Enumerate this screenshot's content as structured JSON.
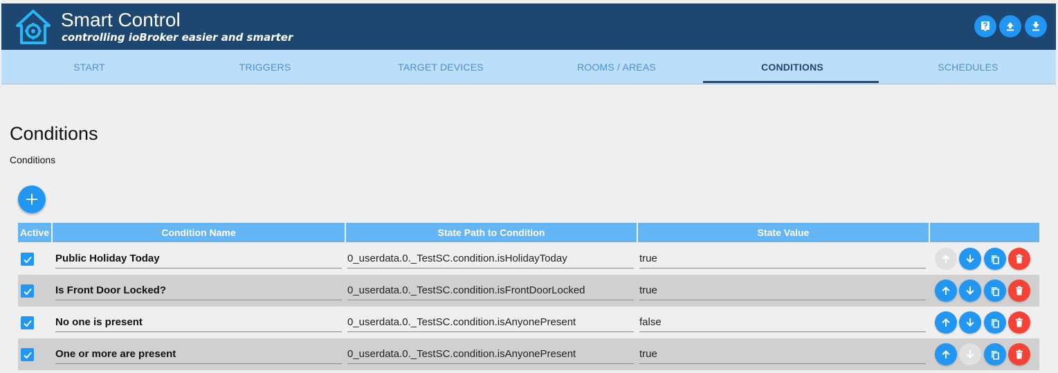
{
  "header": {
    "title": "Smart Control",
    "subtitle": "controlling ioBroker easier and smarter",
    "buttons": [
      {
        "icon": "help-icon"
      },
      {
        "icon": "upload-icon"
      },
      {
        "icon": "download-icon"
      }
    ]
  },
  "tabs": [
    {
      "label": "START"
    },
    {
      "label": "TRIGGERS"
    },
    {
      "label": "TARGET DEVICES"
    },
    {
      "label": "ROOMS / AREAS"
    },
    {
      "label": "CONDITIONS",
      "active": true
    },
    {
      "label": "SCHEDULES"
    }
  ],
  "page": {
    "title": "Conditions",
    "subtitle": "Conditions"
  },
  "table": {
    "headers": {
      "active": "Active",
      "name": "Condition Name",
      "path": "State Path to Condition",
      "value": "State Value"
    },
    "rows": [
      {
        "active": true,
        "name": "Public Holiday Today",
        "path": "0_userdata.0._TestSC.condition.isHolidayToday",
        "value": "true",
        "up_enabled": false,
        "down_enabled": true
      },
      {
        "active": true,
        "name": "Is Front Door Locked?",
        "path": "0_userdata.0._TestSC.condition.isFrontDoorLocked",
        "value": "true",
        "up_enabled": true,
        "down_enabled": true
      },
      {
        "active": true,
        "name": "No one is present",
        "path": "0_userdata.0._TestSC.condition.isAnyonePresent",
        "value": "false",
        "up_enabled": true,
        "down_enabled": true
      },
      {
        "active": true,
        "name": "One or more are present",
        "path": "0_userdata.0._TestSC.condition.isAnyonePresent",
        "value": "true",
        "up_enabled": true,
        "down_enabled": false
      }
    ]
  },
  "colors": {
    "header": "#1d4671",
    "tab_bar": "#bbdefb",
    "accent": "#2196f3",
    "table_header": "#64b5f6",
    "delete": "#f44336"
  }
}
